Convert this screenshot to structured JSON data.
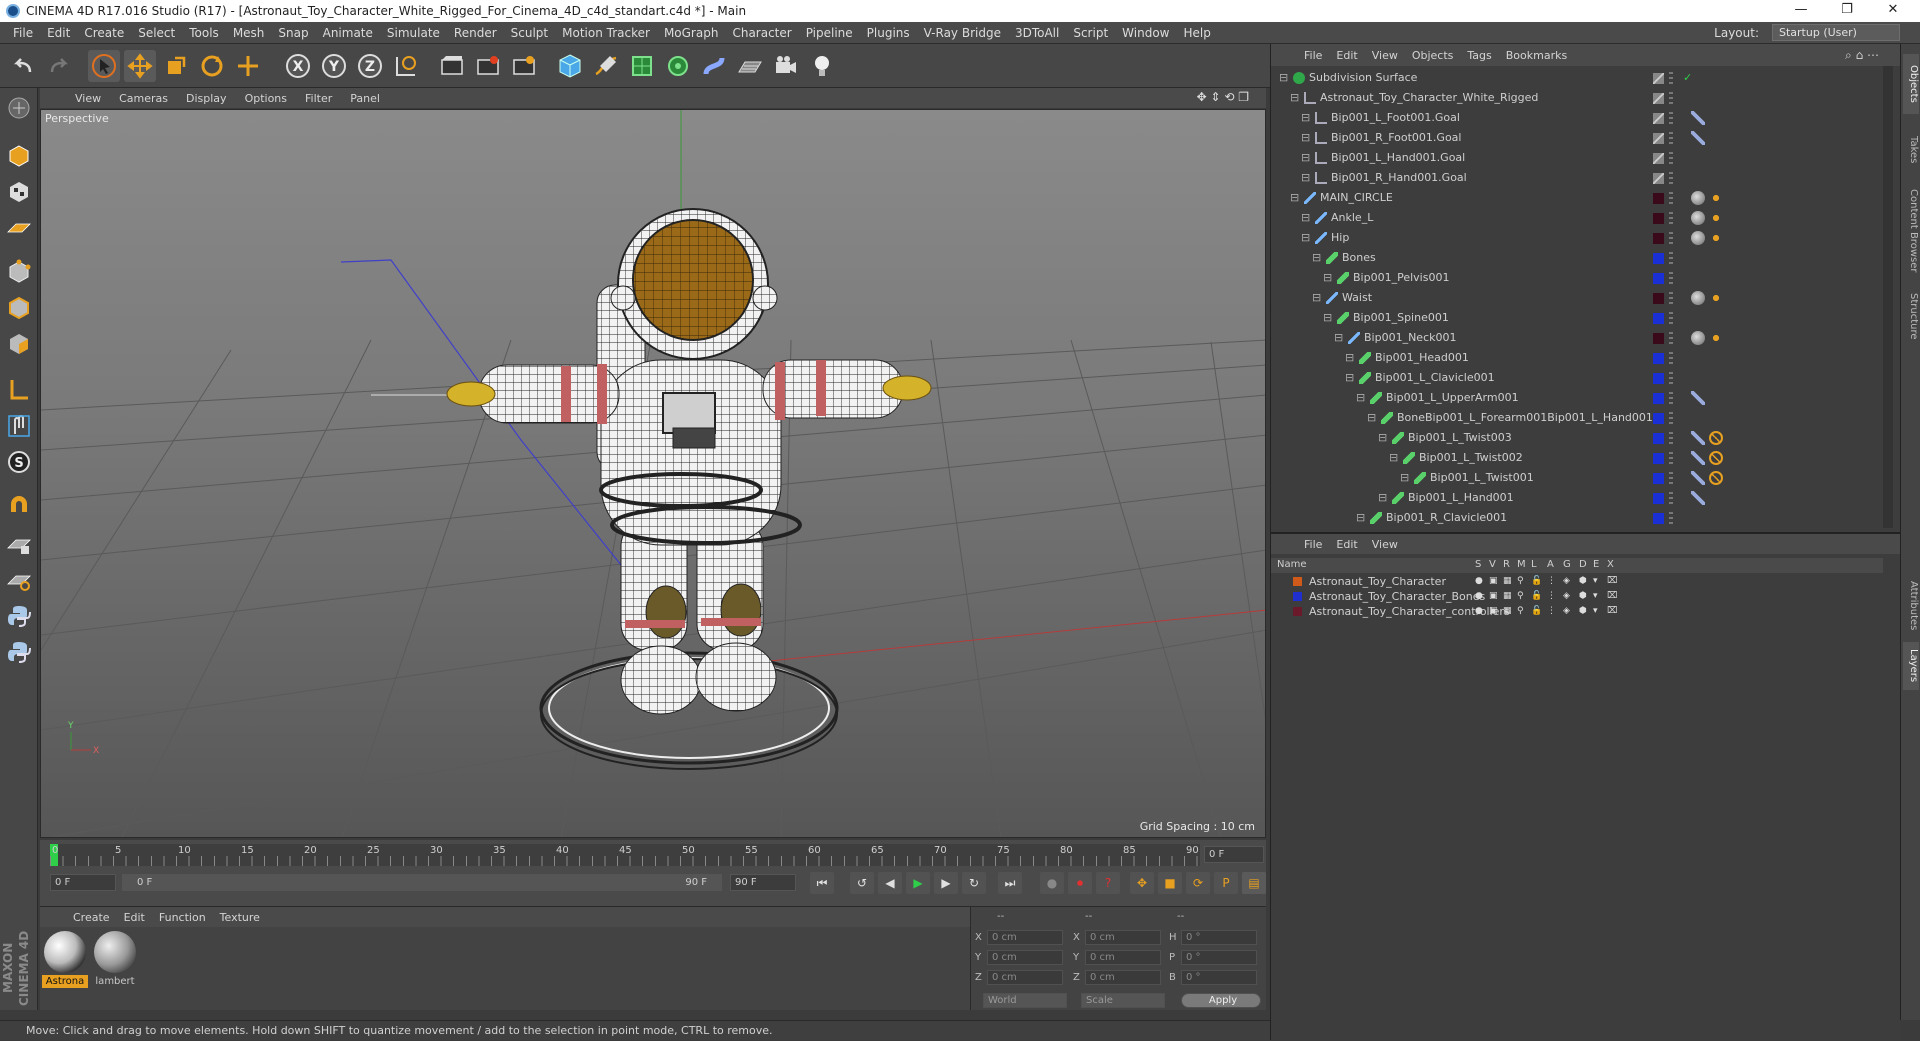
{
  "window": {
    "title": "CINEMA 4D R17.016 Studio (R17) - [Astronaut_Toy_Character_White_Rigged_For_Cinema_4D_c4d_standart.c4d *] - Main",
    "controls": [
      "—",
      "❐",
      "✕"
    ]
  },
  "menubar": {
    "items": [
      "File",
      "Edit",
      "Create",
      "Select",
      "Tools",
      "Mesh",
      "Snap",
      "Animate",
      "Simulate",
      "Render",
      "Sculpt",
      "Motion Tracker",
      "MoGraph",
      "Character",
      "Pipeline",
      "Plugins",
      "V-Ray Bridge",
      "3DToAll",
      "Script",
      "Window",
      "Help"
    ],
    "layout_label": "Layout:",
    "layout_value": "Startup (User)"
  },
  "viewport": {
    "menu": [
      "View",
      "Cameras",
      "Display",
      "Options",
      "Filter",
      "Panel"
    ],
    "camera_label": "Perspective",
    "grid_spacing": "Grid Spacing : 10 cm"
  },
  "timeline": {
    "ticks": [
      "0",
      "5",
      "10",
      "15",
      "20",
      "25",
      "30",
      "35",
      "40",
      "45",
      "50",
      "55",
      "60",
      "65",
      "70",
      "75",
      "80",
      "85",
      "90"
    ],
    "current_frame": "0 F",
    "start_field": "0 F",
    "range_start": "0 F",
    "range_end": "90 F",
    "end_field": "90 F"
  },
  "material_panel": {
    "menu": [
      "Create",
      "Edit",
      "Function",
      "Texture"
    ],
    "materials": [
      {
        "name": "Astrona",
        "selected": true
      },
      {
        "name": "lambert",
        "selected": false
      }
    ]
  },
  "coord_panel": {
    "headers": [
      "--",
      "--",
      "--"
    ],
    "rows": [
      {
        "a": "X",
        "av": "0 cm",
        "b": "X",
        "bv": "0 cm",
        "c": "H",
        "cv": "0 °"
      },
      {
        "a": "Y",
        "av": "0 cm",
        "b": "Y",
        "bv": "0 cm",
        "c": "P",
        "cv": "0 °"
      },
      {
        "a": "Z",
        "av": "0 cm",
        "b": "Z",
        "bv": "0 cm",
        "c": "B",
        "cv": "0 °"
      }
    ],
    "world_select": "World",
    "scale_select": "Scale",
    "apply_label": "Apply"
  },
  "statusbar": {
    "text": "Move: Click and drag to move elements. Hold down SHIFT to quantize movement / add to the selection in point mode, CTRL to remove."
  },
  "branding": {
    "logo_text": "MAXON CINEMA 4D"
  },
  "object_manager": {
    "menu": [
      "File",
      "Edit",
      "View",
      "Objects",
      "Tags",
      "Bookmarks"
    ],
    "objects": [
      {
        "name": "Subdivision Surface",
        "color": "#b0b0b0"
      },
      {
        "name": "Astronaut_Toy_Character_White_Rigged",
        "color": "#b0b0b0"
      },
      {
        "name": "Bip001_L_Foot001.Goal",
        "color": "#b0b0b0"
      },
      {
        "name": "Bip001_R_Foot001.Goal",
        "color": "#b0b0b0"
      },
      {
        "name": "Bip001_L_Hand001.Goal",
        "color": "#b0b0b0"
      },
      {
        "name": "Bip001_R_Hand001.Goal",
        "color": "#b0b0b0"
      },
      {
        "name": "MAIN_CIRCLE",
        "color": "#3a0a1a"
      },
      {
        "name": "Ankle_L",
        "color": "#3a0a1a"
      },
      {
        "name": "Hip",
        "color": "#3a0a1a"
      },
      {
        "name": "Bones",
        "color": "#1a2fd6"
      },
      {
        "name": "Bip001_Pelvis001",
        "color": "#1a2fd6"
      },
      {
        "name": "Waist",
        "color": "#3a0a1a"
      },
      {
        "name": "Bip001_Spine001",
        "color": "#1a2fd6"
      },
      {
        "name": "Bip001_Neck001",
        "color": "#3a0a1a"
      },
      {
        "name": "Bip001_Head001",
        "color": "#1a2fd6"
      },
      {
        "name": "Bip001_L_Clavicle001",
        "color": "#1a2fd6"
      },
      {
        "name": "Bip001_L_UpperArm001",
        "color": "#1a2fd6"
      },
      {
        "name": "BoneBip001_L_Forearm001Bip001_L_Hand001",
        "color": "#1a2fd6"
      },
      {
        "name": "Bip001_L_Twist003",
        "color": "#1a2fd6"
      },
      {
        "name": "Bip001_L_Twist002",
        "color": "#1a2fd6"
      },
      {
        "name": "Bip001_L_Twist001",
        "color": "#1a2fd6"
      },
      {
        "name": "Bip001_L_Hand001",
        "color": "#1a2fd6"
      },
      {
        "name": "Bip001_R_Clavicle001",
        "color": "#1a2fd6"
      }
    ]
  },
  "layer_manager": {
    "menu": [
      "File",
      "Edit",
      "View"
    ],
    "columns": [
      "Name",
      "S",
      "V",
      "R",
      "M",
      "L",
      "A",
      "G",
      "D",
      "E",
      "X"
    ],
    "layers": [
      {
        "name": "Astronaut_Toy_Character",
        "color": "#d05a1a"
      },
      {
        "name": "Astronaut_Toy_Character_Bones",
        "color": "#2030d0"
      },
      {
        "name": "Astronaut_Toy_Character_controllers",
        "color": "#6a1a2a"
      }
    ]
  },
  "side_tabs": [
    "Objects",
    "Takes",
    "Content Browser",
    "Structure",
    "Attributes",
    "Layers"
  ]
}
